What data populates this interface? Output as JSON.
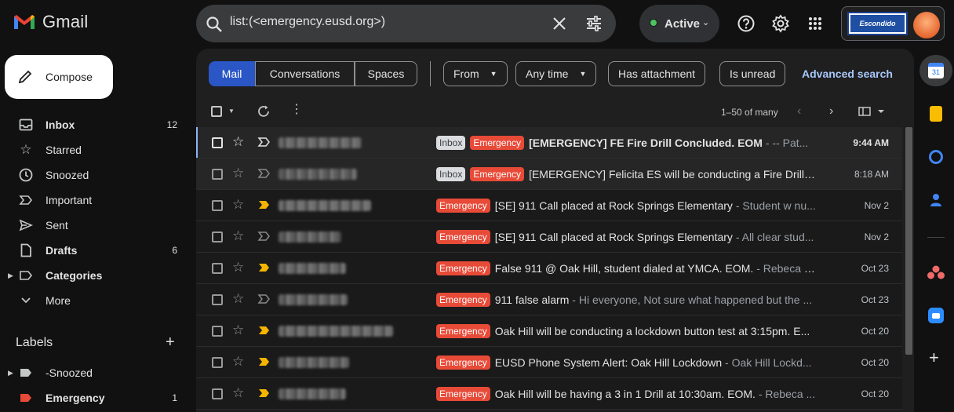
{
  "app": {
    "name": "Gmail"
  },
  "search": {
    "query": "list:(<emergency.eusd.org>)"
  },
  "status": {
    "label": "Active"
  },
  "org_logo": {
    "text": "Escondido"
  },
  "compose": {
    "label": "Compose"
  },
  "nav": [
    {
      "label": "Inbox",
      "count": "12",
      "bold": true,
      "icon": "inbox-icon"
    },
    {
      "label": "Starred",
      "count": "",
      "bold": false,
      "icon": "star-icon"
    },
    {
      "label": "Snoozed",
      "count": "",
      "bold": false,
      "icon": "clock-icon"
    },
    {
      "label": "Important",
      "count": "",
      "bold": false,
      "icon": "important-icon"
    },
    {
      "label": "Sent",
      "count": "",
      "bold": false,
      "icon": "send-icon"
    },
    {
      "label": "Drafts",
      "count": "6",
      "bold": true,
      "icon": "draft-icon"
    },
    {
      "label": "Categories",
      "count": "",
      "bold": true,
      "icon": "label-icon"
    },
    {
      "label": "More",
      "count": "",
      "bold": false,
      "icon": "chevron-down-icon"
    }
  ],
  "labels_header": "Labels",
  "labels": [
    {
      "label": "-Snoozed",
      "count": "",
      "color": "#c4c7c5"
    },
    {
      "label": "Emergency",
      "count": "1",
      "color": "#e84a38"
    }
  ],
  "tabs": {
    "mail": "Mail",
    "conversations": "Conversations",
    "spaces": "Spaces"
  },
  "filters": {
    "from": "From",
    "any_time": "Any time",
    "has_attachment": "Has attachment",
    "is_unread": "Is unread",
    "advanced": "Advanced search"
  },
  "pagination": {
    "range": "1–50 of many"
  },
  "tags": {
    "inbox": "Inbox",
    "emergency": "Emergency"
  },
  "emails": [
    {
      "inbox": true,
      "subject": "[EMERGENCY] FE Fire Drill Concluded. EOM",
      "snippet": " - -- Pat...",
      "date": "9:44 AM",
      "unread": true,
      "important": false
    },
    {
      "inbox": true,
      "subject": "[EMERGENCY] Felicita ES will be conducting a Fire Drill ...",
      "snippet": "",
      "date": "8:18 AM",
      "unread": false,
      "important": false
    },
    {
      "inbox": false,
      "subject": "[SE] 911 Call placed at Rock Springs Elementary",
      "snippet": " - Student w nu...",
      "date": "Nov 2",
      "unread": false,
      "important": true
    },
    {
      "inbox": false,
      "subject": "[SE] 911 Call placed at Rock Springs Elementary",
      "snippet": " - All clear stud...",
      "date": "Nov 2",
      "unread": false,
      "important": false
    },
    {
      "inbox": false,
      "subject": "False 911 @ Oak Hill, student dialed at YMCA. EOM.",
      "snippet": " - Rebeca G...",
      "date": "Oct 23",
      "unread": false,
      "important": true
    },
    {
      "inbox": false,
      "subject": "911 false alarm",
      "snippet": " - Hi everyone, Not sure what happened but the ...",
      "date": "Oct 23",
      "unread": false,
      "important": false
    },
    {
      "inbox": false,
      "subject": "Oak Hill will be conducting a lockdown button test at 3:15pm. E...",
      "snippet": "",
      "date": "Oct 20",
      "unread": false,
      "important": true
    },
    {
      "inbox": false,
      "subject": "EUSD Phone System Alert: Oak Hill Lockdown",
      "snippet": " - Oak Hill Lockd...",
      "date": "Oct 20",
      "unread": false,
      "important": true
    },
    {
      "inbox": false,
      "subject": "Oak Hill will be having a 3 in 1 Drill at 10:30am. EOM.",
      "snippet": " - Rebeca ...",
      "date": "Oct 20",
      "unread": false,
      "important": true
    }
  ]
}
